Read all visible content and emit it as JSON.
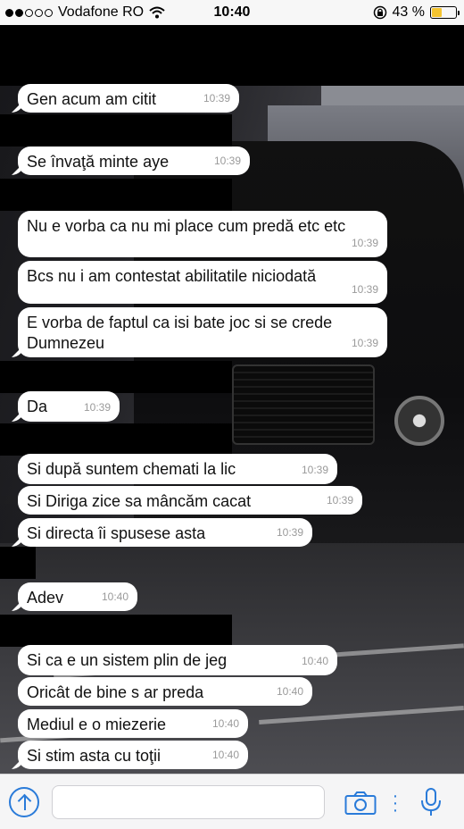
{
  "status_bar": {
    "carrier": "Vodafone RO",
    "time": "10:40",
    "battery_percent": "43 %",
    "battery_level": 0.43,
    "signal_bars_filled": 2,
    "signal_bars_total": 5
  },
  "messages": [
    {
      "text": "Gen acum am citit",
      "time": "10:39"
    },
    {
      "text": "Se învaţă minte aye",
      "time": "10:39"
    },
    {
      "text": "Nu e vorba ca nu mi place cum predă etc etc",
      "time": "10:39"
    },
    {
      "text": "Bcs nu i am contestat abilitatile niciodată",
      "time": "10:39"
    },
    {
      "text": "E vorba de faptul ca isi bate joc si se crede Dumnezeu",
      "time": "10:39"
    },
    {
      "text": "Da",
      "time": "10:39"
    },
    {
      "text": "Si după suntem chemati la lic",
      "time": "10:39"
    },
    {
      "text": "Si Diriga zice sa mâncăm cacat",
      "time": "10:39"
    },
    {
      "text": "Si directa îi spusese asta",
      "time": "10:39"
    },
    {
      "text": "Adev",
      "time": "10:40"
    },
    {
      "text": "Si ca e un sistem plin de jeg",
      "time": "10:40"
    },
    {
      "text": "Oricât de bine s ar preda",
      "time": "10:40"
    },
    {
      "text": "Mediul e o miezerie",
      "time": "10:40"
    },
    {
      "text": "Si stim asta cu toţii",
      "time": "10:40"
    }
  ],
  "input_bar": {
    "placeholder": "",
    "accent_color": "#2a7bd9"
  },
  "icons": {
    "upload": "upload-arrow-icon",
    "camera": "camera-icon",
    "more": "more-icon",
    "mic": "microphone-icon"
  }
}
